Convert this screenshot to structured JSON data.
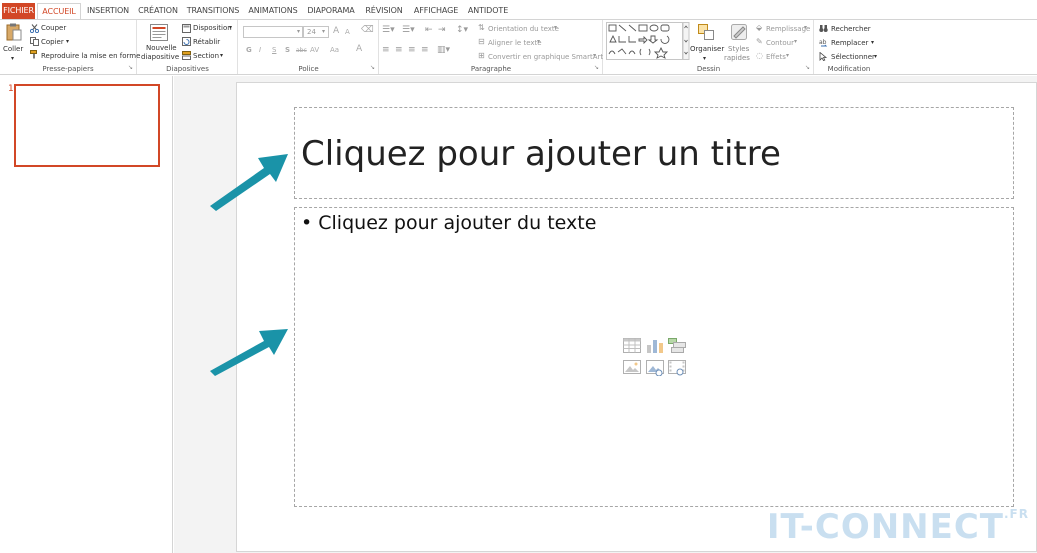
{
  "tabs": {
    "file": "FICHIER",
    "home": "ACCUEIL",
    "insert": "INSERTION",
    "design": "CRÉATION",
    "transitions": "TRANSITIONS",
    "animations": "ANIMATIONS",
    "slideshow": "DIAPORAMA",
    "review": "RÉVISION",
    "view": "AFFICHAGE",
    "antidote": "ANTIDOTE"
  },
  "clipboard": {
    "paste": "Coller",
    "cut": "Couper",
    "copy": "Copier",
    "format_painter": "Reproduire la mise en forme",
    "label": "Presse-papiers"
  },
  "slides_group": {
    "new_slide_line1": "Nouvelle",
    "new_slide_line2": "diapositive",
    "layout": "Disposition",
    "reset": "Rétablir",
    "section": "Section",
    "label": "Diapositives"
  },
  "font": {
    "size": "24",
    "bold": "G",
    "italic": "I",
    "underline": "S",
    "shadow": "S",
    "strike": "abc",
    "spacing": "AV",
    "case": "Aa",
    "grow": "A",
    "shrink": "A",
    "color": "A",
    "label": "Police"
  },
  "paragraph": {
    "text_direction": "Orientation du texte",
    "align_text": "Aligner le texte",
    "smartart": "Convertir en graphique SmartArt",
    "label": "Paragraphe"
  },
  "drawing": {
    "arrange": "Organiser",
    "quick_styles_line1": "Styles",
    "quick_styles_line2": "rapides",
    "fill": "Remplissage",
    "outline": "Contour",
    "effects": "Effets",
    "label": "Dessin"
  },
  "editing": {
    "find": "Rechercher",
    "replace": "Remplacer",
    "select": "Sélectionner",
    "label": "Modification"
  },
  "thumbnails": {
    "slide_number": "1"
  },
  "slide": {
    "title_placeholder": "Cliquez pour ajouter un titre",
    "content_placeholder": "Cliquez pour ajouter du texte",
    "bullet": "•"
  },
  "watermark": {
    "main": "IT-CONNECT",
    "suffix": ".FR"
  },
  "colors": {
    "accent": "#d24726",
    "arrow": "#1a93a8",
    "watermark": "#c9dff0"
  }
}
